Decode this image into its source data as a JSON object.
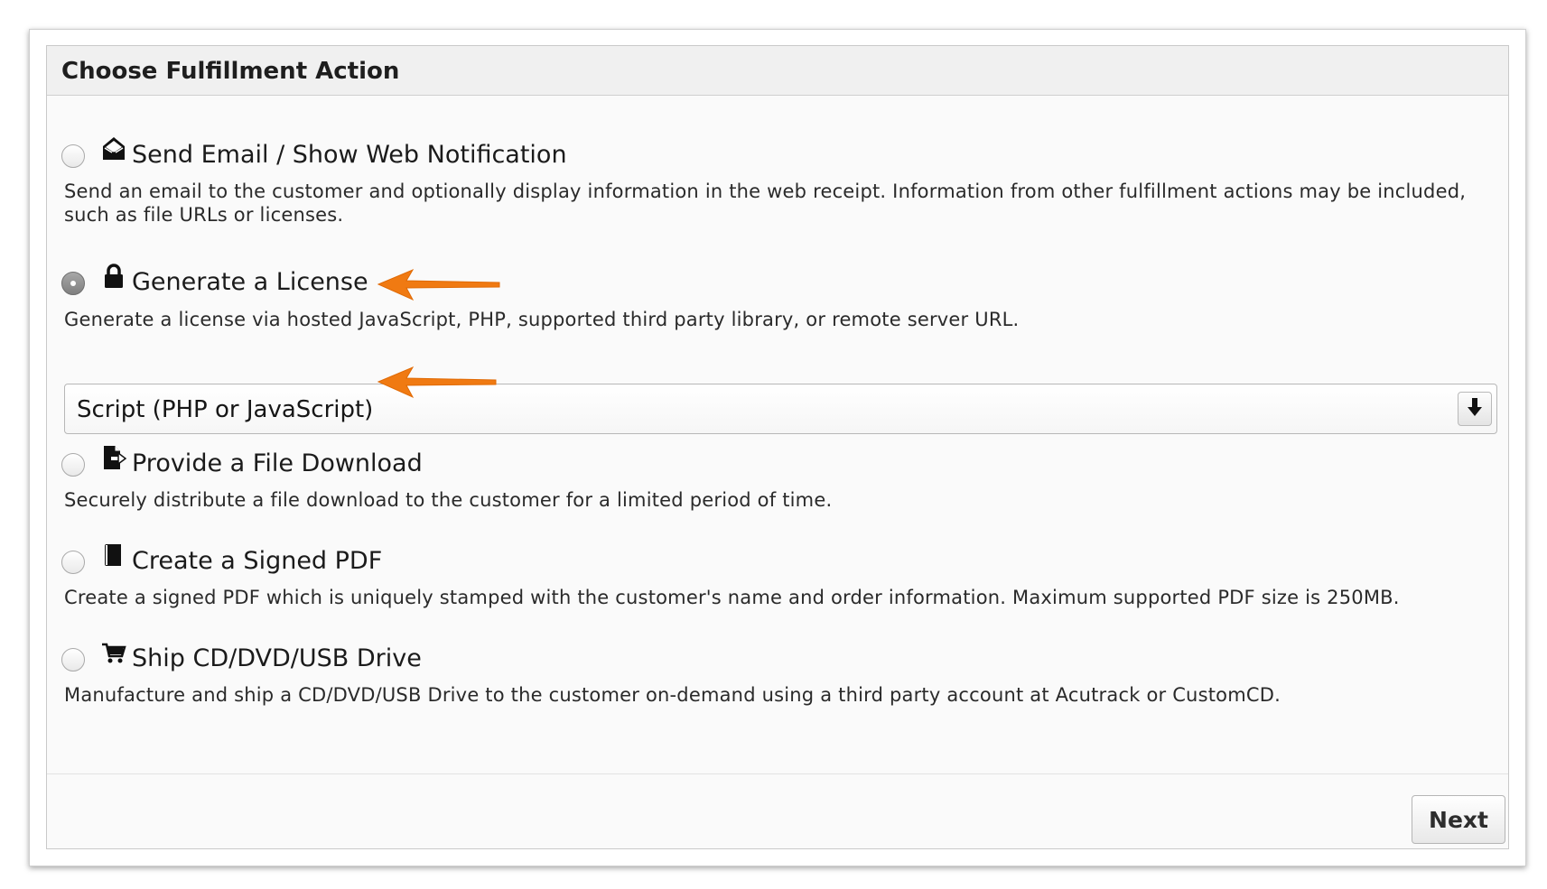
{
  "panel": {
    "title": "Choose Fulfillment Action"
  },
  "options": [
    {
      "label": "Send Email / Show Web Notification",
      "description": "Send an email to the customer and optionally display information in the web receipt. Information from other fulfillment actions may be included, such as file URLs or licenses.",
      "icon": "envelope-open-icon",
      "selected": false
    },
    {
      "label": "Generate a License",
      "description": "Generate a license via hosted JavaScript, PHP, supported third party library, or remote server URL.",
      "icon": "lock-icon",
      "selected": true
    },
    {
      "label": "Provide a File Download",
      "description": "Securely distribute a file download to the customer for a limited period of time.",
      "icon": "file-export-icon",
      "selected": false
    },
    {
      "label": "Create a Signed PDF",
      "description": "Create a signed PDF which is uniquely stamped with the customer's name and order information. Maximum supported PDF size is 250MB.",
      "icon": "book-icon",
      "selected": false
    },
    {
      "label": "Ship CD/DVD/USB Drive",
      "description": "Manufacture and ship a CD/DVD/USB Drive to the customer on-demand using a third party account at Acutrack or CustomCD.",
      "icon": "shopping-cart-icon",
      "selected": false
    }
  ],
  "license_type_select": {
    "value": "Script (PHP or JavaScript)",
    "icon": "arrow-down-icon"
  },
  "footer": {
    "next_label": "Next"
  },
  "colors": {
    "annotation_arrow": "#f07a12",
    "panel_background": "#fafafa",
    "header_background": "#f0f0f0"
  }
}
